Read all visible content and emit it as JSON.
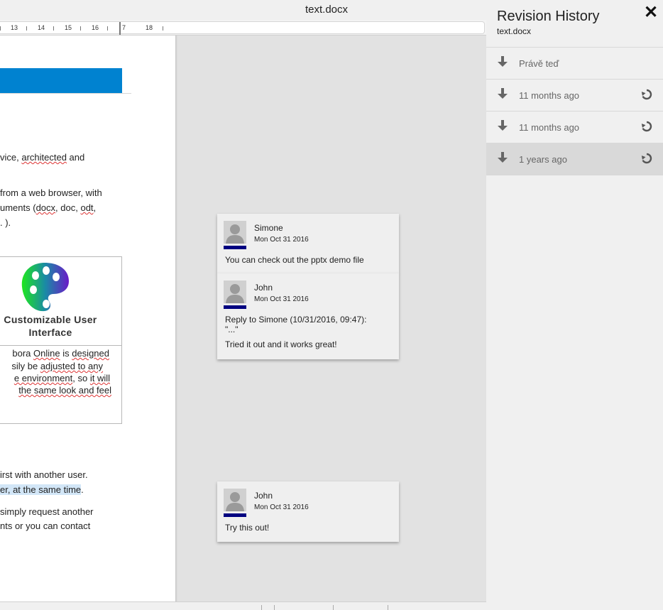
{
  "title_bar": {
    "document_title": "text.docx"
  },
  "ruler": {
    "numbers": [
      "13",
      "14",
      "15",
      "16",
      "7",
      "18"
    ]
  },
  "document": {
    "lines": [
      {
        "parts": [
          {
            "t": "vice, "
          },
          {
            "t": "architected",
            "squiggle": true
          },
          {
            "t": " and"
          }
        ]
      },
      {
        "parts": [
          {
            "t": "from a web browser, with"
          }
        ]
      },
      {
        "parts": [
          {
            "t": "uments ("
          },
          {
            "t": "docx",
            "squiggle": true
          },
          {
            "t": ", doc, "
          },
          {
            "t": "odt",
            "squiggle": true
          },
          {
            "t": ","
          }
        ]
      },
      {
        "parts": [
          {
            "t": ". )."
          }
        ]
      }
    ],
    "feature_box": {
      "title_line1": "Customizable User",
      "title_line2": "Interface",
      "body_lines": [
        {
          "parts": [
            {
              "t": "bora "
            },
            {
              "t": "Online",
              "squiggle": true
            },
            {
              "t": " is "
            },
            {
              "t": "designed",
              "squiggle": true
            }
          ]
        },
        {
          "parts": [
            {
              "t": "sily be "
            },
            {
              "t": "adjusted to any",
              "squiggle": true
            }
          ]
        },
        {
          "parts": [
            {
              "t": "e environment",
              "squiggle": true
            },
            {
              "t": ", so "
            },
            {
              "t": "it will",
              "squiggle": true
            }
          ]
        },
        {
          "parts": [
            {
              "t": " the same look and feel",
              "squiggle": true
            }
          ]
        }
      ]
    },
    "lower_lines": [
      {
        "parts": [
          {
            "t": "irst with another user."
          }
        ]
      },
      {
        "parts": [
          {
            "t": "er, at the same time",
            "highlight": true
          },
          {
            "t": "."
          }
        ]
      },
      {
        "parts": [
          {
            "t": "simply request another"
          }
        ]
      },
      {
        "parts": [
          {
            "t": "nts or you can contact"
          }
        ]
      }
    ]
  },
  "comments": [
    {
      "items": [
        {
          "author": "Simone",
          "date": "Mon Oct 31 2016",
          "text_lines": [
            "You can check out the pptx demo file"
          ]
        }
      ]
    },
    {
      "items": [
        {
          "author": "John",
          "date": "Mon Oct 31 2016",
          "text_lines": [
            "Reply to Simone (10/31/2016, 09:47):",
            "\"...\"",
            "Tried it out and it works great!"
          ]
        }
      ]
    },
    {
      "items": [
        {
          "author": "John",
          "date": "Mon Oct 31 2016",
          "text_lines": [
            "Try this out!"
          ]
        }
      ]
    }
  ],
  "revision_history": {
    "title": "Revision History",
    "subtitle": "text.docx",
    "close_icon": "close-icon",
    "items": [
      {
        "label": "Právě teď",
        "has_restore": false,
        "selected": false
      },
      {
        "label": "11 months ago",
        "has_restore": true,
        "selected": false
      },
      {
        "label": "11 months ago",
        "has_restore": true,
        "selected": false
      },
      {
        "label": "1 years ago",
        "has_restore": true,
        "selected": true
      }
    ]
  },
  "colors": {
    "header_bar": "#0082d0",
    "author_bar": "#000080",
    "selected_revision": "#d9d9d9"
  }
}
